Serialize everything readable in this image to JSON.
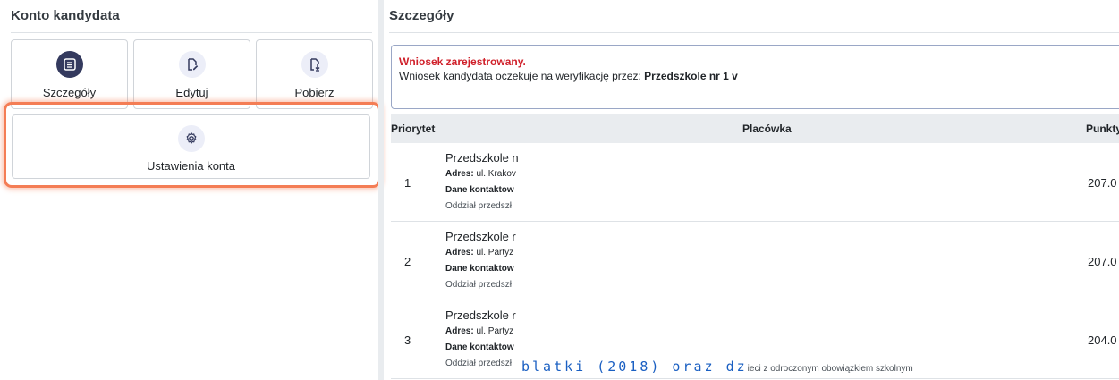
{
  "left": {
    "title": "Konto kandydata",
    "tiles": [
      {
        "label": "Szczegóły",
        "icon": "list-icon"
      },
      {
        "label": "Edytuj",
        "icon": "document-edit-icon"
      },
      {
        "label": "Pobierz",
        "icon": "document-download-icon"
      },
      {
        "label": "Ustawienia konta",
        "icon": "gear-icon"
      }
    ]
  },
  "right": {
    "title": "Szczegóły",
    "alert": {
      "title": "Wniosek zarejestrowany.",
      "text": "Wniosek kandydata oczekuje na weryfikację przez:",
      "strong": "Przedszkole nr 1 v"
    },
    "table": {
      "headers": {
        "priority": "Priorytet",
        "facility": "Placówka",
        "points": "Punkty"
      },
      "rows": [
        {
          "priority": "1",
          "name": "Przedszkole n",
          "address_label": "Adres:",
          "address": "ul. Krakov",
          "contact_label": "Dane kontaktow",
          "department": "Oddział przedszł",
          "points": "207.0"
        },
        {
          "priority": "2",
          "name": "Przedszkole r",
          "address_label": "Adres:",
          "address": "ul. Partyz",
          "contact_label": "Dane kontaktow",
          "department": "Oddział przedszł",
          "points": "207.0"
        },
        {
          "priority": "3",
          "name": "Przedszkole r",
          "address_label": "Adres:",
          "address": "ul. Partyz",
          "contact_label": "Dane kontaktow",
          "department": "Oddział przedszł",
          "department_tail_big": "blatki (2018) oraz dz",
          "department_tail": "ieci z odroczonym obowiązkiem szkolnym",
          "points": "204.0"
        }
      ]
    }
  },
  "colors": {
    "highlight": "#f47d55",
    "alert_title": "#d0202a",
    "icon_dark_bg": "#343a5e",
    "icon_light_bg": "#eceef8"
  }
}
